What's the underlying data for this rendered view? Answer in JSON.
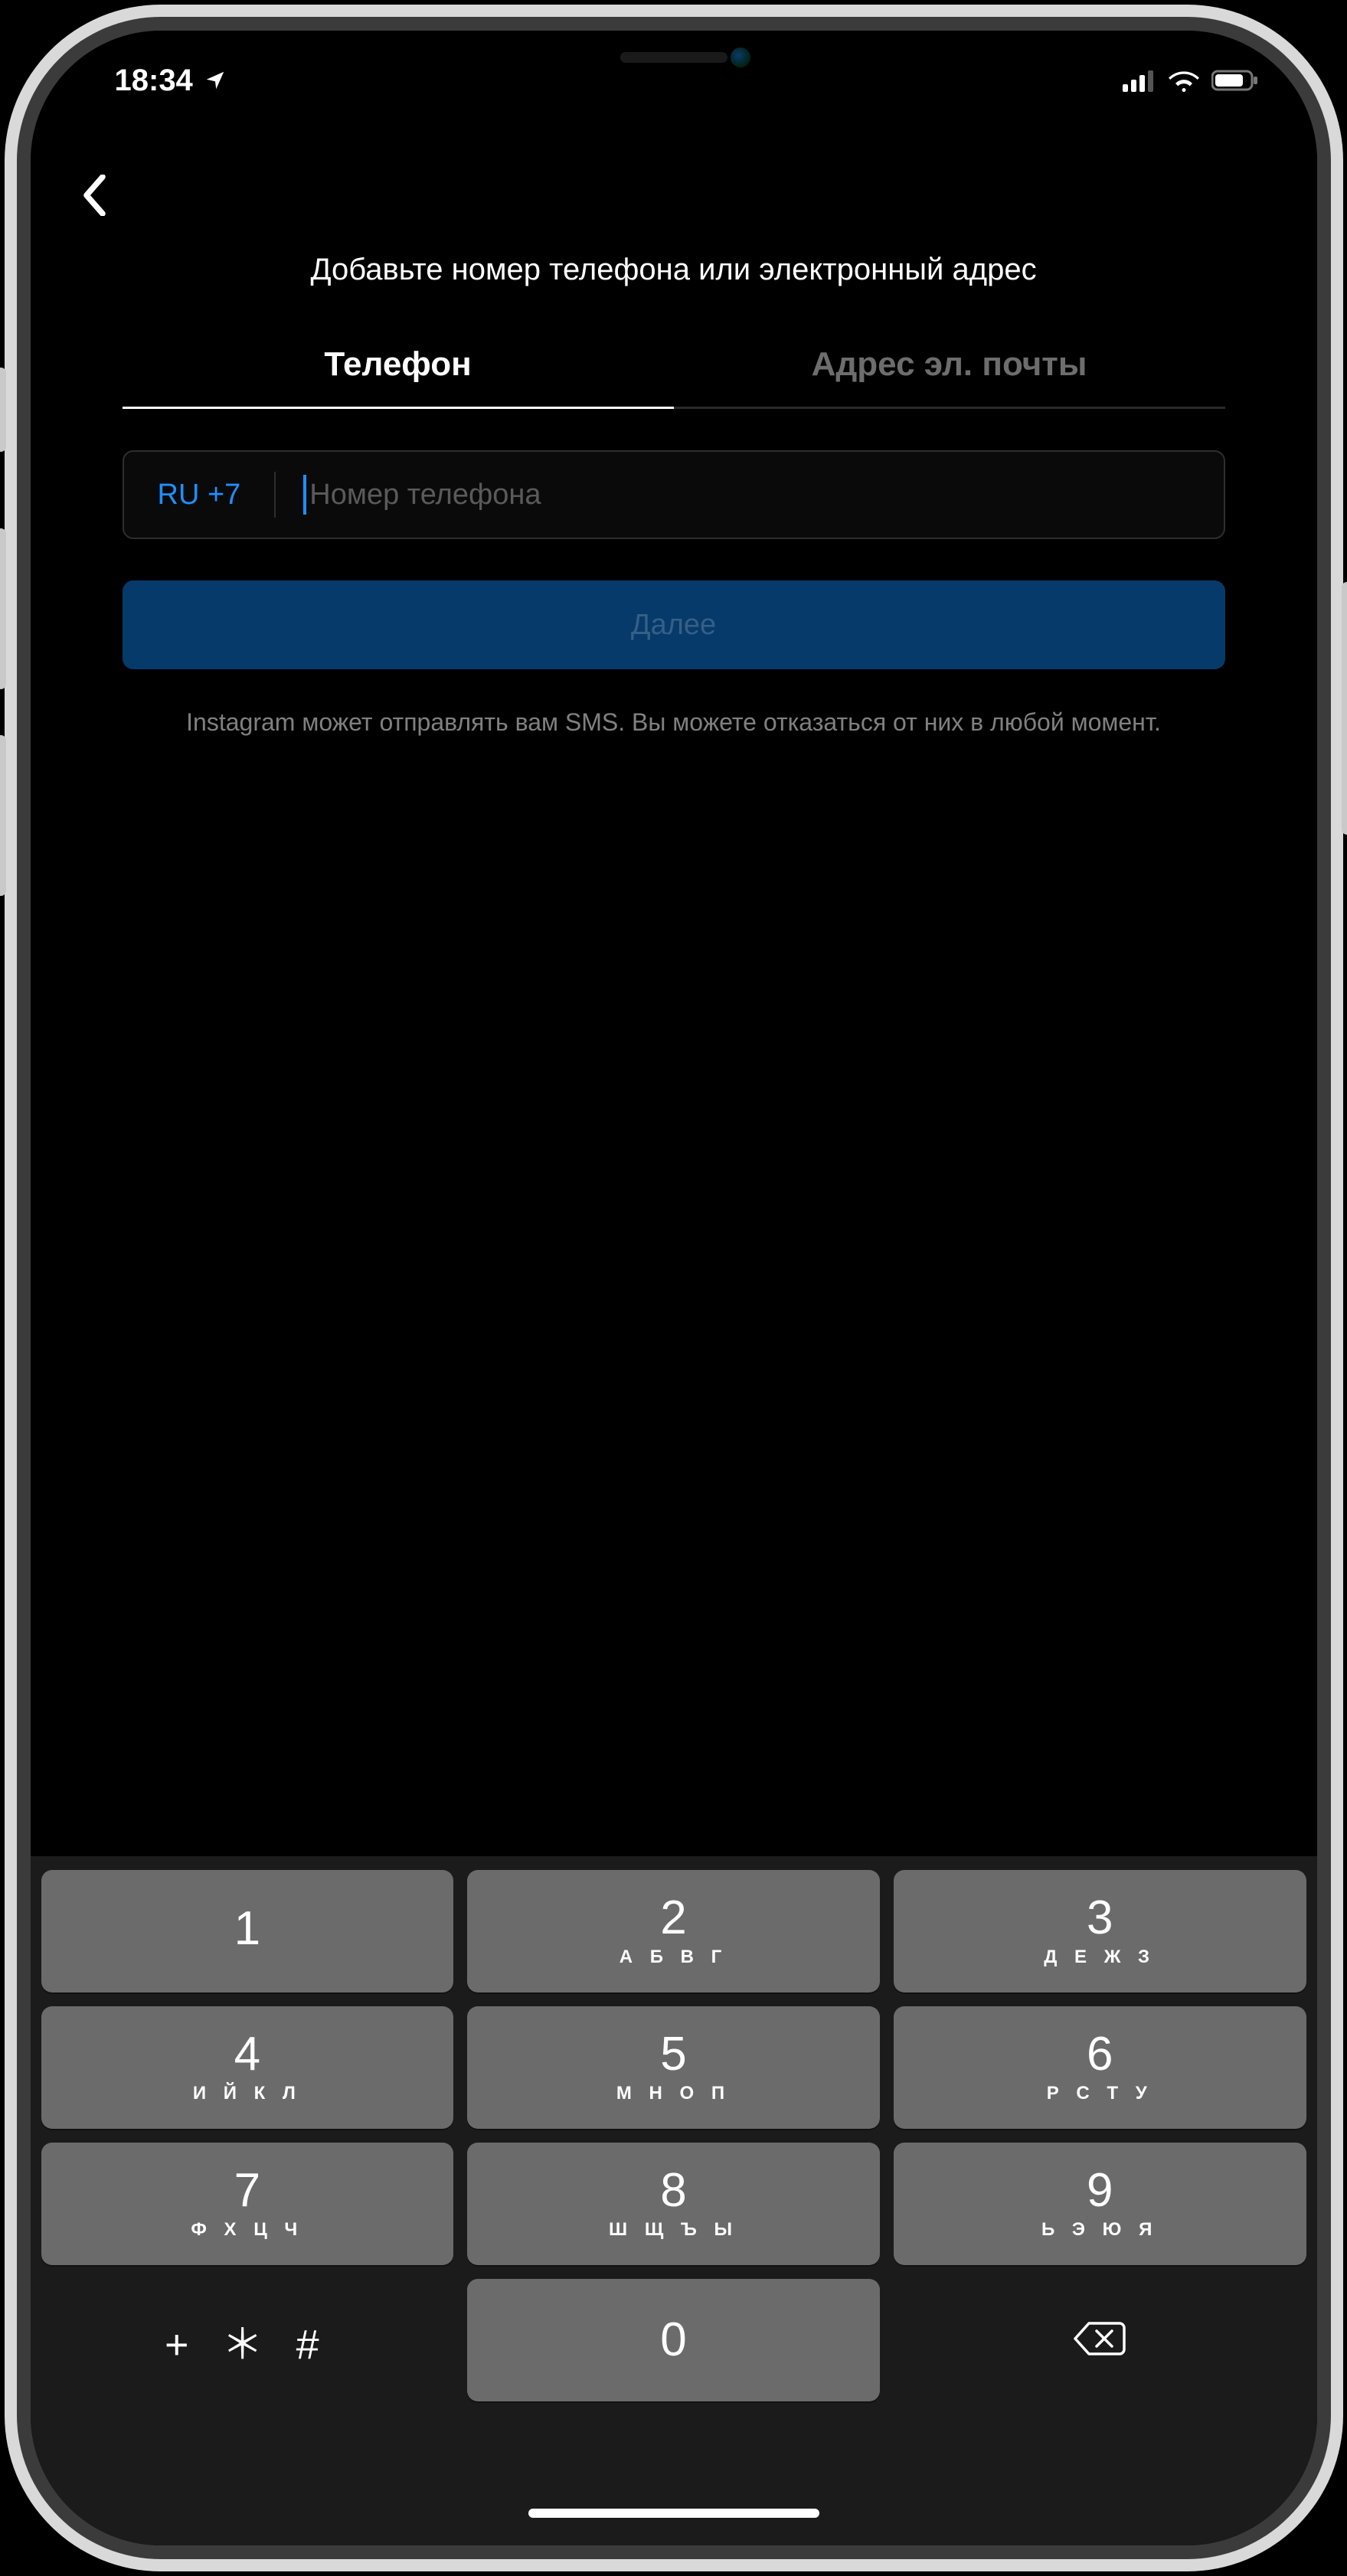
{
  "status": {
    "time": "18:34"
  },
  "header": {
    "title": "Добавьте номер телефона или электронный адрес"
  },
  "tabs": {
    "phone": "Телефон",
    "email": "Адрес эл. почты"
  },
  "input": {
    "country_code": "RU +7",
    "placeholder": "Номер телефона"
  },
  "actions": {
    "next": "Далее"
  },
  "notes": {
    "sms": "Instagram может отправлять вам SMS. Вы можете отказаться от них в любой момент."
  },
  "keyboard": {
    "k1": {
      "d": "1",
      "l": ""
    },
    "k2": {
      "d": "2",
      "l": "А Б В Г"
    },
    "k3": {
      "d": "3",
      "l": "Д Е Ж З"
    },
    "k4": {
      "d": "4",
      "l": "И Й К Л"
    },
    "k5": {
      "d": "5",
      "l": "М Н О П"
    },
    "k6": {
      "d": "6",
      "l": "Р С Т У"
    },
    "k7": {
      "d": "7",
      "l": "Ф Х Ц Ч"
    },
    "k8": {
      "d": "8",
      "l": "Ш Щ Ъ Ы"
    },
    "k9": {
      "d": "9",
      "l": "Ь Э Ю Я"
    },
    "k0": {
      "d": "0",
      "l": ""
    },
    "sym": "+ ＊ #"
  }
}
